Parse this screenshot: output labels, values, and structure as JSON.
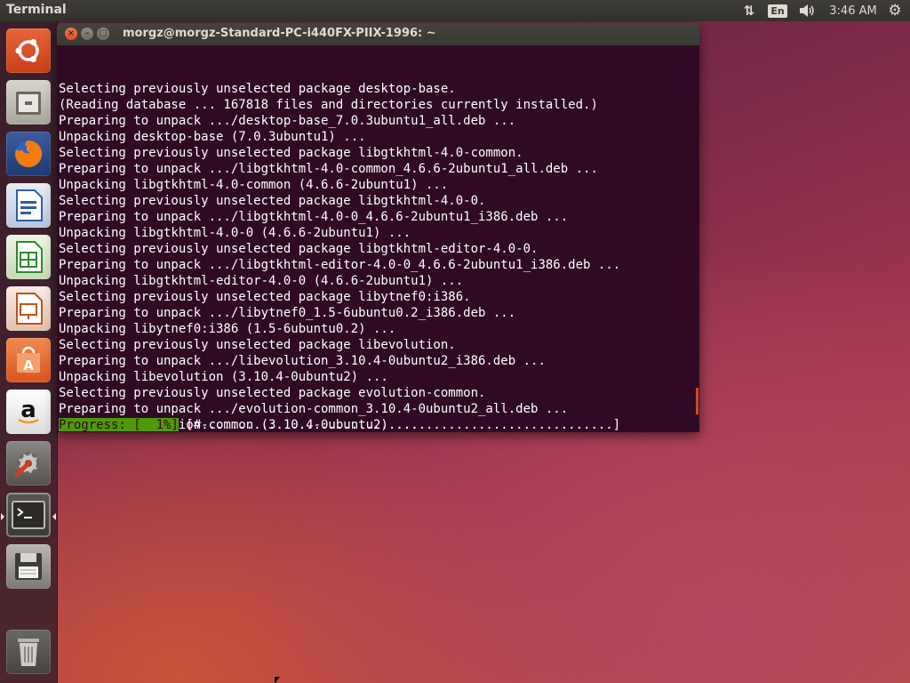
{
  "top_panel": {
    "app_name": "Terminal",
    "keyboard_layout": "En",
    "clock": "3:46 AM",
    "icons": [
      "network-icon",
      "keyboard-layout-icon",
      "volume-icon",
      "settings-gear-icon"
    ]
  },
  "launcher": {
    "items": [
      {
        "name": "ubuntu-dash",
        "icon": "ubuntu-logo-icon"
      },
      {
        "name": "files",
        "icon": "file-cabinet-icon"
      },
      {
        "name": "firefox",
        "icon": "firefox-icon"
      },
      {
        "name": "libreoffice-writer",
        "icon": "writer-document-icon"
      },
      {
        "name": "libreoffice-calc",
        "icon": "calc-spreadsheet-icon"
      },
      {
        "name": "libreoffice-impress",
        "icon": "impress-presentation-icon"
      },
      {
        "name": "ubuntu-software",
        "icon": "software-center-bag-icon"
      },
      {
        "name": "amazon",
        "icon": "amazon-icon"
      },
      {
        "name": "system-settings",
        "icon": "settings-wrench-icon"
      },
      {
        "name": "terminal",
        "icon": "terminal-icon"
      },
      {
        "name": "save-disk",
        "icon": "floppy-disk-icon"
      },
      {
        "name": "trash",
        "icon": "trash-icon"
      }
    ]
  },
  "terminal": {
    "title": "morgz@morgz-Standard-PC-i440FX-PIIX-1996: ~",
    "lines": [
      "Selecting previously unselected package desktop-base.",
      "(Reading database ... 167818 files and directories currently installed.)",
      "Preparing to unpack .../desktop-base_7.0.3ubuntu1_all.deb ...",
      "Unpacking desktop-base (7.0.3ubuntu1) ...",
      "Selecting previously unselected package libgtkhtml-4.0-common.",
      "Preparing to unpack .../libgtkhtml-4.0-common_4.6.6-2ubuntu1_all.deb ...",
      "Unpacking libgtkhtml-4.0-common (4.6.6-2ubuntu1) ...",
      "Selecting previously unselected package libgtkhtml-4.0-0.",
      "Preparing to unpack .../libgtkhtml-4.0-0_4.6.6-2ubuntu1_i386.deb ...",
      "Unpacking libgtkhtml-4.0-0 (4.6.6-2ubuntu1) ...",
      "Selecting previously unselected package libgtkhtml-editor-4.0-0.",
      "Preparing to unpack .../libgtkhtml-editor-4.0-0_4.6.6-2ubuntu1_i386.deb ...",
      "Unpacking libgtkhtml-editor-4.0-0 (4.6.6-2ubuntu1) ...",
      "Selecting previously unselected package libytnef0:i386.",
      "Preparing to unpack .../libytnef0_1.5-6ubuntu0.2_i386.deb ...",
      "Unpacking libytnef0:i386 (1.5-6ubuntu0.2) ...",
      "Selecting previously unselected package libevolution.",
      "Preparing to unpack .../libevolution_3.10.4-0ubuntu2_i386.deb ...",
      "Unpacking libevolution (3.10.4-0ubuntu2) ...",
      "Selecting previously unselected package evolution-common.",
      "Preparing to unpack .../evolution-common_3.10.4-0ubuntu2_all.deb ...",
      "Unpacking evolution-common (3.10.4-0ubuntu2) ..."
    ],
    "progress_label": "Progress: [  1%]",
    "progress_bar": " [#.......................................................]",
    "progress_percent": 1
  },
  "colors": {
    "terminal_bg": "#300a24",
    "progress_green": "#4e9a06",
    "accent_orange": "#e95420"
  }
}
